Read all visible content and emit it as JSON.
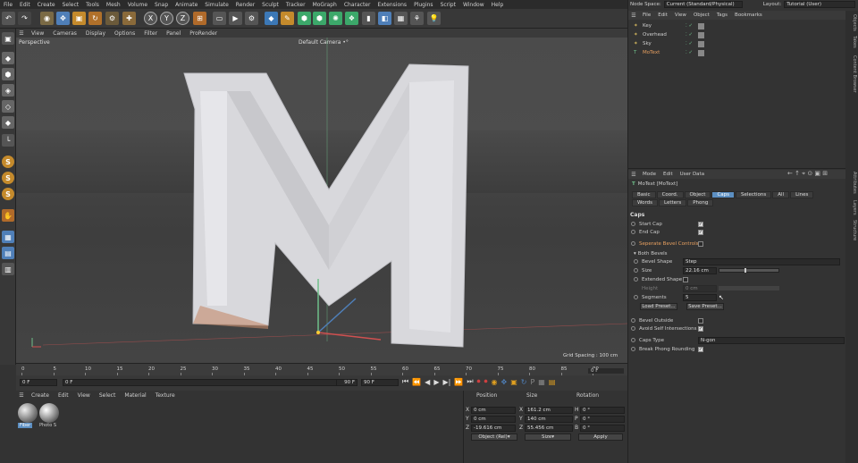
{
  "menu": [
    "File",
    "Edit",
    "Create",
    "Select",
    "Tools",
    "Mesh",
    "Volume",
    "Snap",
    "Animate",
    "Simulate",
    "Render",
    "Sculpt",
    "Tracker",
    "MoGraph",
    "Character",
    "Extensions",
    "Plugins",
    "Script",
    "Window",
    "Help"
  ],
  "header": {
    "node_space_label": "Node Space:",
    "node_space_value": "Current (Standard/Physical)",
    "layout_label": "Layout:",
    "layout_value": "Tutorial (User)"
  },
  "toolbar": {
    "x": "X",
    "y": "Y",
    "z": "Z"
  },
  "left_tools": {
    "s1": "S",
    "s2": "S",
    "s3": "S"
  },
  "viewport": {
    "menu": [
      "View",
      "Cameras",
      "Display",
      "Options",
      "Filter",
      "Panel",
      "ProRender"
    ],
    "name": "Perspective",
    "camera": "Default Camera",
    "camera_mark": "•°",
    "grid_spacing": "Grid Spacing : 100 cm",
    "letter": "M"
  },
  "timeline": {
    "ticks": [
      "0",
      "5",
      "10",
      "15",
      "20",
      "25",
      "30",
      "35",
      "40",
      "45",
      "50",
      "55",
      "60",
      "65",
      "70",
      "75",
      "80",
      "85",
      "90"
    ],
    "end_frame": "0 F"
  },
  "transport": {
    "current": "0 F",
    "start": "0 F",
    "end_a": "90 F",
    "end_b": "90 F"
  },
  "material_panel": {
    "menu": [
      "Create",
      "Edit",
      "View",
      "Select",
      "Material",
      "Texture"
    ],
    "materials": [
      "Fiber",
      "Photo S"
    ]
  },
  "coords": {
    "headers": [
      "Position",
      "Size",
      "Rotation"
    ],
    "rows": [
      {
        "axis": "X",
        "pos": "0 cm",
        "axis2": "X",
        "size": "161.2 cm",
        "rot_axis": "H",
        "rot": "0 °"
      },
      {
        "axis": "Y",
        "pos": "0 cm",
        "axis2": "Y",
        "size": "140 cm",
        "rot_axis": "P",
        "rot": "0 °"
      },
      {
        "axis": "Z",
        "pos": "-19.616 cm",
        "axis2": "Z",
        "size": "55.456 cm",
        "rot_axis": "B",
        "rot": "0 °"
      }
    ],
    "mode": "Object (Rel)",
    "size_mode": "Size",
    "apply": "Apply"
  },
  "objects_panel": {
    "menu": [
      "File",
      "Edit",
      "View",
      "Object",
      "Tags",
      "Bookmarks"
    ],
    "items": [
      {
        "name": "Key",
        "color": "#cfcfcf"
      },
      {
        "name": "Overhead",
        "color": "#cfcfcf"
      },
      {
        "name": "Sky",
        "color": "#cfcfcf"
      },
      {
        "name": "MoText",
        "color": "#e8a060"
      }
    ]
  },
  "side_tabs_top": [
    "Objects",
    "Takes",
    "Content Browser"
  ],
  "side_tabs_bottom": [
    "Attributes",
    "Layers",
    "Structure"
  ],
  "attributes": {
    "menu": [
      "Mode",
      "Edit",
      "User Data"
    ],
    "title": "MoText [MoText]",
    "tabs_row1": [
      "Basic",
      "Coord.",
      "Object",
      "Caps",
      "Selections",
      "All",
      "Lines"
    ],
    "tabs_row2": [
      "Words",
      "Letters",
      "Phong"
    ],
    "active_tab": "Caps",
    "section": "Caps",
    "start_cap": "Start Cap",
    "end_cap": "End Cap",
    "separate_bevel": "Seperate Bevel Controls",
    "both_bevels": "Both Bevels",
    "bevel_shape_label": "Bevel Shape",
    "bevel_shape_value": "Step",
    "size_label": "Size",
    "size_value": "22.16 cm",
    "extended_shape": "Extended Shape",
    "height_label": "Height",
    "height_value": "0 cm",
    "segments_label": "Segments",
    "segments_value": "5",
    "load_preset": "Load Preset...",
    "save_preset": "Save Preset...",
    "bevel_outside": "Bevel Outside",
    "avoid_self": "Avoid Self Intersections",
    "caps_type_label": "Caps Type",
    "caps_type_value": "N-gon",
    "break_phong": "Break Phong Rounding"
  },
  "colors": {
    "accent": "#5c8fc2",
    "highlight": "#e8a060",
    "viewport": "#4a4a4a"
  }
}
